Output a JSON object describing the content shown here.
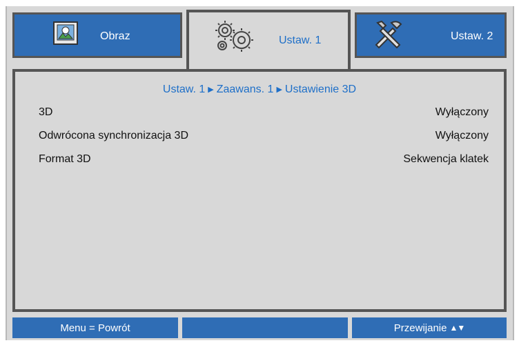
{
  "tabs": [
    {
      "label": "Obraz",
      "icon": "image-settings-icon"
    },
    {
      "label": "Ustaw. 1",
      "icon": "gears-icon"
    },
    {
      "label": "Ustaw. 2",
      "icon": "tools-icon"
    }
  ],
  "breadcrumb": {
    "part1": "Ustaw. 1",
    "part2": "Zaawans. 1",
    "part3": "Ustawienie 3D",
    "separator": "▶"
  },
  "settings": [
    {
      "label": "3D",
      "value": "Wyłączony"
    },
    {
      "label": "Odwrócona synchronizacja 3D",
      "value": "Wyłączony"
    },
    {
      "label": "Format 3D",
      "value": "Sekwencja klatek"
    }
  ],
  "footer": {
    "left": "Menu = Powrót",
    "middle": "",
    "right": "Przewijanie",
    "right_arrows": "▲▼"
  },
  "colors": {
    "tab_blue": "#2f6db5",
    "panel_gray": "#d8d8d8",
    "active_text": "#1e6fc8"
  }
}
